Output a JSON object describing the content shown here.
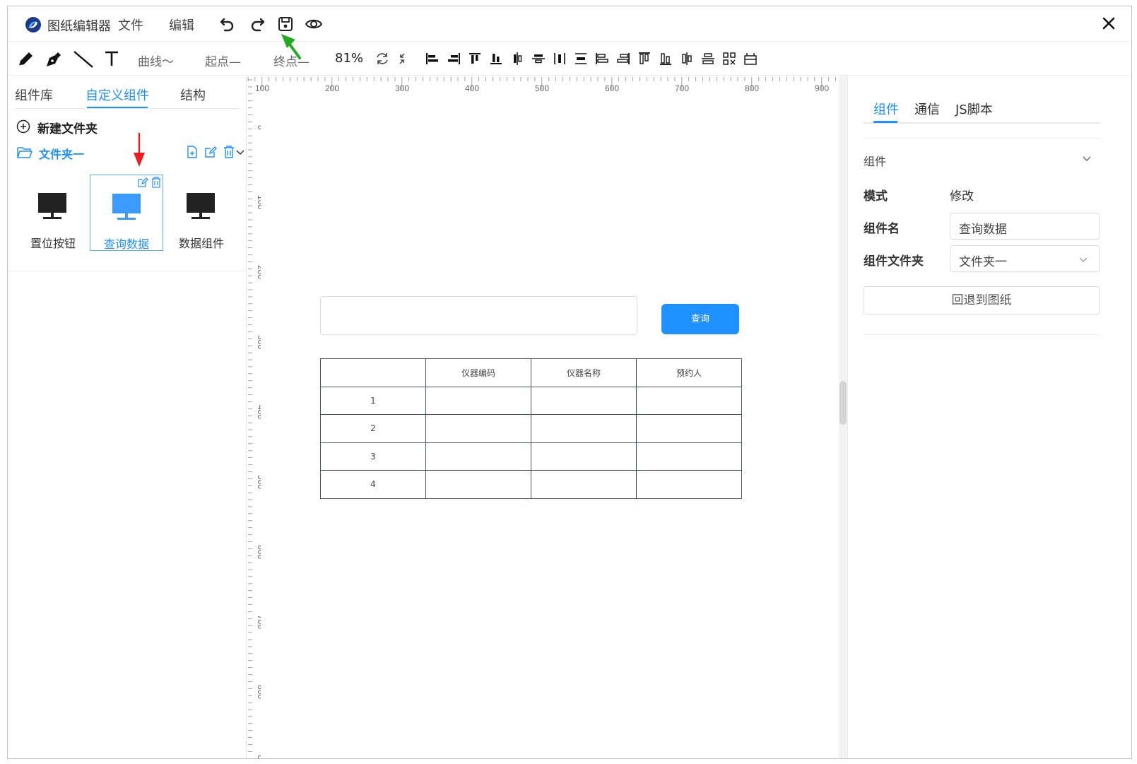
{
  "title_bar": {
    "app_title": "图纸编辑器",
    "menus": [
      "文件",
      "编辑"
    ],
    "icons": [
      "undo-icon",
      "redo-icon",
      "save-icon",
      "preview-eye-icon"
    ],
    "close_icon": "close-icon"
  },
  "toolbar": {
    "curve_label": "曲线～",
    "start_label": "起点—",
    "end_label": "终点—",
    "zoom": "81%",
    "drawing_tools": [
      "pencil-icon",
      "pen-icon",
      "line-icon",
      "text-icon"
    ],
    "align_tools_count_label": ""
  },
  "left_panel": {
    "tabs": [
      {
        "label": "组件库",
        "active": false
      },
      {
        "label": "自定义组件",
        "active": true
      },
      {
        "label": "结构",
        "active": false
      }
    ],
    "new_folder_label": "新建文件夹",
    "folder_name": "文件夹一",
    "components": [
      {
        "label": "置位按钮",
        "selected": false
      },
      {
        "label": "查询数据",
        "selected": true
      },
      {
        "label": "数据组件",
        "selected": false
      }
    ]
  },
  "ruler": {
    "top_labels": [
      "100",
      "200",
      "300",
      "400",
      "500",
      "600",
      "700",
      "800",
      "900"
    ],
    "left_labels": [
      "0",
      "100",
      "200",
      "300",
      "400",
      "500",
      "600",
      "700",
      "800",
      "0"
    ]
  },
  "canvas": {
    "query_input_value": "",
    "query_button_label": "查询",
    "table": {
      "headers": [
        "",
        "仪器编码",
        "仪器名称",
        "预约人"
      ],
      "rows": [
        [
          "1",
          "",
          "",
          ""
        ],
        [
          "2",
          "",
          "",
          ""
        ],
        [
          "3",
          "",
          "",
          ""
        ],
        [
          "4",
          "",
          "",
          ""
        ]
      ]
    }
  },
  "right_panel": {
    "tabs": [
      {
        "label": "组件",
        "active": true
      },
      {
        "label": "通信",
        "active": false
      },
      {
        "label": "JS脚本",
        "active": false
      }
    ],
    "section_title": "组件",
    "mode_label": "模式",
    "mode_value": "修改",
    "name_label": "组件名",
    "name_value": "查询数据",
    "folder_label": "组件文件夹",
    "folder_value": "文件夹一",
    "back_button_label": "回退到图纸"
  },
  "colors": {
    "accent": "#1e90ff",
    "table_border": "#4b4f63",
    "annotation_red": "#ee1c1c",
    "annotation_green": "#22aa22"
  }
}
